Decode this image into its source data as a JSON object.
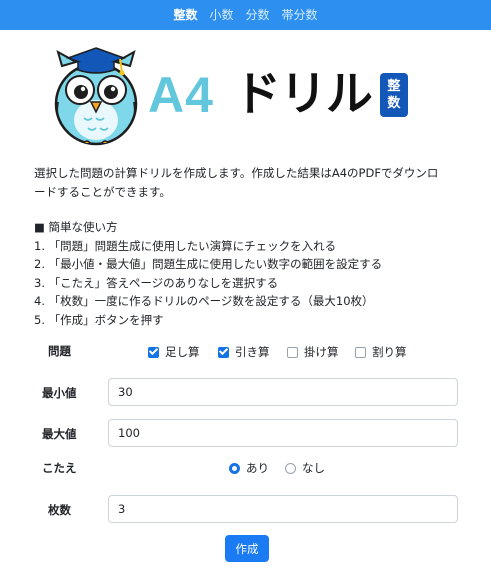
{
  "nav": {
    "tabs": [
      {
        "label": "整数",
        "active": true
      },
      {
        "label": "小数",
        "active": false
      },
      {
        "label": "分数",
        "active": false
      },
      {
        "label": "帯分数",
        "active": false
      }
    ]
  },
  "logo": {
    "a4": "A4",
    "drill": "ドリル",
    "badge_line1": "整",
    "badge_line2": "数"
  },
  "intro": {
    "line1": "選択した問題の計算ドリルを作成します。作成した結果はA4のPDFでダウンロ",
    "line2": "ードすることができます。"
  },
  "howto": {
    "title": "■ 簡単な使い方",
    "steps": [
      "1. 「問題」問題生成に使用したい演算にチェックを入れる",
      "2. 「最小値・最大値」問題生成に使用したい数字の範囲を設定する",
      "3. 「こたえ」答えページのありなしを選択する",
      "4. 「枚数」一度に作るドリルのページ数を設定する（最大10枚）",
      "5. 「作成」ボタンを押す"
    ]
  },
  "form": {
    "problem_label": "問題",
    "ops": [
      {
        "label": "足し算",
        "checked": true
      },
      {
        "label": "引き算",
        "checked": true
      },
      {
        "label": "掛け算",
        "checked": false
      },
      {
        "label": "割り算",
        "checked": false
      }
    ],
    "min_label": "最小値",
    "min_value": "30",
    "max_label": "最大値",
    "max_value": "100",
    "answer_label": "こたえ",
    "answer_options": [
      {
        "label": "あり",
        "selected": true
      },
      {
        "label": "なし",
        "selected": false
      }
    ],
    "sheets_label": "枚数",
    "sheets_value": "3",
    "create_label": "作成"
  },
  "colors": {
    "nav_bg": "#2d8ff0",
    "accent": "#1473e6",
    "logo_a4": "#62c7dd",
    "badge": "#1358b8"
  }
}
